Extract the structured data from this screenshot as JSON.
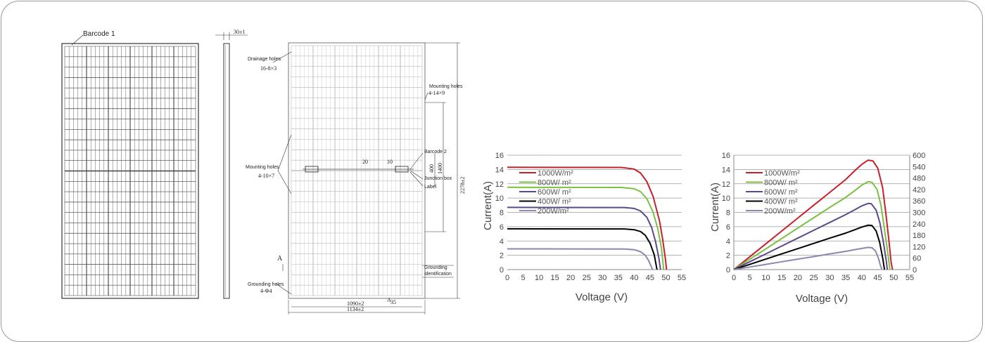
{
  "front_view": {
    "barcode_label": "Barcode 1"
  },
  "side_view": {
    "thickness_label": "30±1"
  },
  "back_view": {
    "drainage_holes_label": "Drainage holes",
    "drainage_holes_spec": "16-8×3",
    "mounting_holes_top_label": "Mounting holes",
    "mounting_holes_top_spec": "4-14×9",
    "mounting_holes_left_label": "Mounting holes",
    "mounting_holes_left_spec": "4-10×7",
    "barcode2_label": "Barcode 2",
    "junction_box_label": "Junction box",
    "label_label": "Label",
    "grounding_label": "Grounding",
    "grounding_identification": "identification",
    "grounding_holes_label": "Grounding holes",
    "grounding_holes_spec": "4-Φ4",
    "section_mark": "A",
    "dim_width_inner": "1090±2",
    "dim_width_outer": "1134±2",
    "dim_height": "2278±2",
    "dim_400": "400",
    "dim_1400": "1400",
    "dim_20": "20",
    "dim_10": "10",
    "dim_a": "A",
    "dim_35": "35"
  },
  "colors": {
    "c1000": "#c8202a",
    "c800": "#7ac143",
    "c600": "#5b4a8b",
    "c400": "#000000",
    "c200": "#8f85b0",
    "grid": "#9a9a9a"
  },
  "chart_data": [
    {
      "type": "line",
      "title": "",
      "xlabel": "Voltage  (V)",
      "ylabel": "Current(A)",
      "xlim": [
        0,
        55
      ],
      "ylim": [
        0,
        16
      ],
      "xticks": [
        0,
        5,
        10,
        15,
        20,
        25,
        30,
        35,
        40,
        45,
        50,
        55
      ],
      "yticks": [
        0,
        2,
        4,
        6,
        8,
        10,
        12,
        14,
        16
      ],
      "grid": "horizontal",
      "legend": "top-left",
      "series": [
        {
          "name": "1000W/m²",
          "points": [
            [
              0,
              14.3
            ],
            [
              36,
              14.28
            ],
            [
              40,
              14.05
            ],
            [
              42,
              13.5
            ],
            [
              44,
              12.3
            ],
            [
              46,
              10.2
            ],
            [
              48,
              6.8
            ],
            [
              49,
              4.2
            ],
            [
              49.8,
              1.6
            ],
            [
              50.2,
              0
            ]
          ]
        },
        {
          "name": "800W/ m²",
          "points": [
            [
              0,
              11.5
            ],
            [
              36,
              11.48
            ],
            [
              40,
              11.3
            ],
            [
              42,
              10.9
            ],
            [
              44,
              9.9
            ],
            [
              46,
              8.0
            ],
            [
              47.5,
              5.6
            ],
            [
              48.6,
              3.0
            ],
            [
              49.3,
              0
            ]
          ]
        },
        {
          "name": "600W/ m²",
          "points": [
            [
              0,
              8.7
            ],
            [
              37,
              8.68
            ],
            [
              40,
              8.55
            ],
            [
              42,
              8.2
            ],
            [
              44,
              7.3
            ],
            [
              45.5,
              5.9
            ],
            [
              46.8,
              3.8
            ],
            [
              47.8,
              1.6
            ],
            [
              48.3,
              0
            ]
          ]
        },
        {
          "name": "400W/ m²",
          "points": [
            [
              0,
              5.7
            ],
            [
              37,
              5.68
            ],
            [
              40,
              5.58
            ],
            [
              42,
              5.32
            ],
            [
              43.5,
              4.8
            ],
            [
              45,
              3.7
            ],
            [
              46.3,
              2.1
            ],
            [
              47.2,
              0
            ]
          ]
        },
        {
          "name": "200W/m²",
          "points": [
            [
              0,
              2.9
            ],
            [
              37,
              2.88
            ],
            [
              40,
              2.78
            ],
            [
              42,
              2.5
            ],
            [
              43.5,
              2.0
            ],
            [
              44.5,
              1.3
            ],
            [
              45.3,
              0.5
            ],
            [
              45.8,
              0
            ]
          ]
        }
      ]
    },
    {
      "type": "line",
      "title": "",
      "xlabel": "Voltage  (V)",
      "ylabel": "Current(A)",
      "xlim": [
        0,
        55
      ],
      "ylim": [
        0,
        16
      ],
      "y2lim": [
        0,
        600
      ],
      "xticks": [
        0,
        5,
        10,
        15,
        20,
        25,
        30,
        35,
        40,
        45,
        50,
        55
      ],
      "yticks": [
        0,
        2,
        4,
        6,
        8,
        10,
        12,
        14,
        16
      ],
      "y2ticks": [
        0,
        60,
        120,
        180,
        240,
        300,
        360,
        420,
        480,
        540,
        600
      ],
      "grid": "horizontal",
      "legend": "top-left",
      "series": [
        {
          "name": "1000W/m²",
          "points": [
            [
              0,
              0
            ],
            [
              5,
              1.8
            ],
            [
              10,
              3.6
            ],
            [
              15,
              5.4
            ],
            [
              20,
              7.2
            ],
            [
              25,
              9.0
            ],
            [
              30,
              10.8
            ],
            [
              35,
              12.6
            ],
            [
              38,
              13.9
            ],
            [
              40,
              14.7
            ],
            [
              42,
              15.3
            ],
            [
              43.5,
              15.2
            ],
            [
              45,
              14.2
            ],
            [
              46.5,
              11.5
            ],
            [
              47.5,
              8.0
            ],
            [
              48.5,
              4.0
            ],
            [
              49.2,
              1.0
            ],
            [
              49.6,
              0
            ]
          ]
        },
        {
          "name": "800W/ m²",
          "points": [
            [
              0,
              0
            ],
            [
              5,
              1.45
            ],
            [
              10,
              2.9
            ],
            [
              15,
              4.35
            ],
            [
              20,
              5.8
            ],
            [
              25,
              7.25
            ],
            [
              30,
              8.7
            ],
            [
              35,
              10.1
            ],
            [
              38,
              11.1
            ],
            [
              40,
              11.8
            ],
            [
              42,
              12.3
            ],
            [
              43.2,
              12.2
            ],
            [
              44.8,
              11.2
            ],
            [
              46,
              9.0
            ],
            [
              47,
              6.0
            ],
            [
              48,
              2.8
            ],
            [
              48.8,
              0
            ]
          ]
        },
        {
          "name": "600W/ m²",
          "points": [
            [
              0,
              0
            ],
            [
              5,
              1.1
            ],
            [
              10,
              2.2
            ],
            [
              15,
              3.3
            ],
            [
              20,
              4.4
            ],
            [
              25,
              5.5
            ],
            [
              30,
              6.6
            ],
            [
              35,
              7.7
            ],
            [
              38,
              8.4
            ],
            [
              40,
              8.9
            ],
            [
              42,
              9.25
            ],
            [
              43,
              9.2
            ],
            [
              44.5,
              8.3
            ],
            [
              45.7,
              6.5
            ],
            [
              46.7,
              4.0
            ],
            [
              47.6,
              1.4
            ],
            [
              48,
              0
            ]
          ]
        },
        {
          "name": "400W/ m²",
          "points": [
            [
              0,
              0
            ],
            [
              5,
              0.73
            ],
            [
              10,
              1.46
            ],
            [
              15,
              2.2
            ],
            [
              20,
              2.93
            ],
            [
              25,
              3.66
            ],
            [
              30,
              4.4
            ],
            [
              35,
              5.1
            ],
            [
              38,
              5.6
            ],
            [
              40,
              5.95
            ],
            [
              42,
              6.2
            ],
            [
              43.2,
              6.15
            ],
            [
              44.5,
              5.4
            ],
            [
              45.6,
              3.8
            ],
            [
              46.6,
              1.5
            ],
            [
              47.1,
              0
            ]
          ]
        },
        {
          "name": "200W/m²",
          "points": [
            [
              0,
              0
            ],
            [
              5,
              0.36
            ],
            [
              10,
              0.73
            ],
            [
              15,
              1.1
            ],
            [
              20,
              1.46
            ],
            [
              25,
              1.82
            ],
            [
              30,
              2.2
            ],
            [
              35,
              2.55
            ],
            [
              38,
              2.8
            ],
            [
              40,
              2.95
            ],
            [
              42,
              3.1
            ],
            [
              43.2,
              3.05
            ],
            [
              44.3,
              2.6
            ],
            [
              45.2,
              1.6
            ],
            [
              45.9,
              0.5
            ],
            [
              46.3,
              0
            ]
          ]
        }
      ]
    }
  ]
}
